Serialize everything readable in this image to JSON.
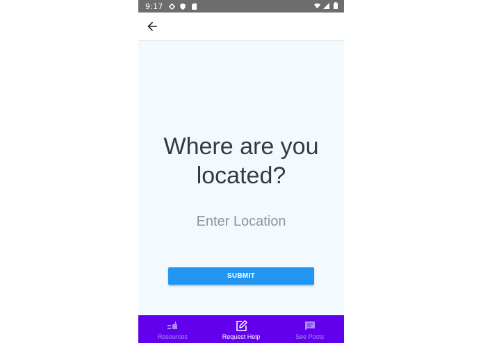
{
  "status_bar": {
    "time": "9:17",
    "left_icons": [
      "settings-icon",
      "shield-icon",
      "sd-card-icon"
    ],
    "right_icons": [
      "wifi-icon",
      "signal-icon",
      "battery-icon"
    ]
  },
  "app_bar": {
    "back_icon": "arrow-back-icon"
  },
  "main": {
    "question_line1": "Where are you",
    "question_line2": "located?",
    "location_placeholder": "Enter Location",
    "location_value": "",
    "submit_label": "SUBMIT"
  },
  "bottom_nav": {
    "items": [
      {
        "label": "Resources",
        "icon": "resources-icon",
        "active": false
      },
      {
        "label": "Request Help",
        "icon": "edit-icon",
        "active": true
      },
      {
        "label": "See Posts",
        "icon": "chat-icon",
        "active": false
      }
    ]
  },
  "colors": {
    "nav_background": "#6200ee",
    "button": "#2196f3",
    "page_background": "#f2faff",
    "status_bar": "#6d6d6d"
  }
}
